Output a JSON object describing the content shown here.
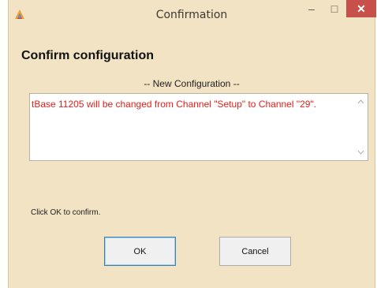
{
  "window": {
    "title": "Confirmation",
    "minimize_glyph": "–",
    "maximize_glyph": "□",
    "close_glyph": "✕"
  },
  "dialog": {
    "heading": "Confirm configuration",
    "section_label": "-- New Configuration --",
    "message": "tBase 11205 will be changed from Channel \"Setup\" to Channel \"29\".",
    "confirm_text": "Click OK to confirm.",
    "ok_label": "OK",
    "cancel_label": "Cancel"
  },
  "colors": {
    "window_bg": "#f2e3c4",
    "message_text": "#e2211c",
    "close_button": "#c7504a"
  },
  "icons": {
    "app": "app-icon",
    "scroll_up": "chevron-up-icon",
    "scroll_down": "chevron-down-icon"
  }
}
